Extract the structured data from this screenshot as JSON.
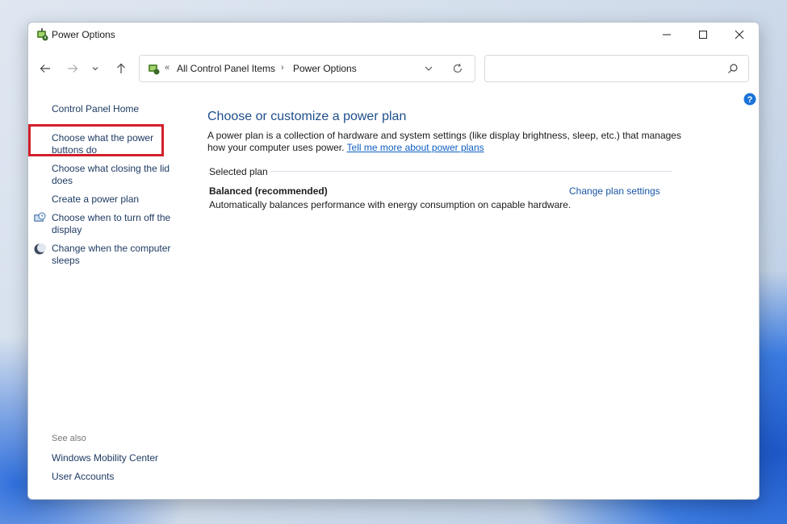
{
  "window": {
    "title": "Power Options"
  },
  "address_bar": {
    "overflow_chevron": "«",
    "crumbs": [
      "All Control Panel Items",
      "Power Options"
    ],
    "separator": "›"
  },
  "search": {
    "value": "",
    "placeholder": ""
  },
  "sidebar": {
    "home_link": "Control Panel Home",
    "items": [
      {
        "label": "Choose what the power buttons do",
        "highlighted": true
      },
      {
        "label": "Choose what closing the lid does"
      },
      {
        "label": "Create a power plan"
      },
      {
        "label": "Choose when to turn off the display",
        "icon": "monitor-clock-icon"
      },
      {
        "label": "Change when the computer sleeps",
        "icon": "moon-icon"
      }
    ],
    "see_also_label": "See also",
    "see_also_items": [
      "Windows Mobility Center",
      "User Accounts"
    ]
  },
  "main": {
    "heading": "Choose or customize a power plan",
    "description": "A power plan is a collection of hardware and system settings (like display brightness, sleep, etc.) that manages how your computer uses power.",
    "description_link": "Tell me more about power plans",
    "section_label": "Selected plan",
    "plan": {
      "name": "Balanced (recommended)",
      "change_link": "Change plan settings",
      "description": "Automatically balances performance with energy consumption on capable hardware."
    }
  },
  "colors": {
    "link": "#1a56a6",
    "heading": "#1e4e8c",
    "highlight": "#d21f2b"
  }
}
